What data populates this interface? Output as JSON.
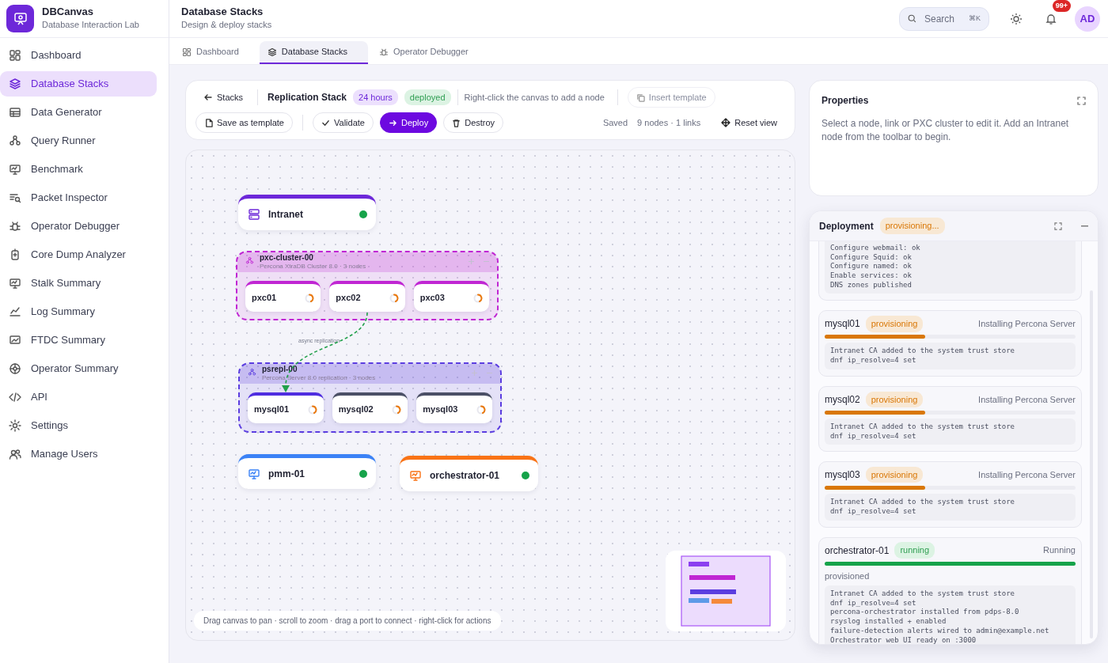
{
  "app": {
    "name": "DBCanvas",
    "subtitle": "Database Interaction Lab"
  },
  "sidebar": {
    "items": [
      {
        "label": "Dashboard",
        "selected": false
      },
      {
        "label": "Database Stacks",
        "selected": true
      },
      {
        "label": "Data Generator",
        "selected": false
      },
      {
        "label": "Query Runner",
        "selected": false
      },
      {
        "label": "Benchmark",
        "selected": false
      },
      {
        "label": "Packet Inspector",
        "selected": false
      },
      {
        "label": "Operator Debugger",
        "selected": false
      },
      {
        "label": "Core Dump Analyzer",
        "selected": false
      },
      {
        "label": "Stalk Summary",
        "selected": false
      },
      {
        "label": "Log Summary",
        "selected": false
      },
      {
        "label": "FTDC Summary",
        "selected": false
      },
      {
        "label": "Operator Summary",
        "selected": false
      },
      {
        "label": "API",
        "selected": false
      },
      {
        "label": "Settings",
        "selected": false
      },
      {
        "label": "Manage Users",
        "selected": false
      }
    ]
  },
  "header": {
    "title": "Database Stacks",
    "subtitle": "Design & deploy stacks",
    "search": {
      "placeholder": "Search",
      "shortcut": "⌘K"
    },
    "notifications": "99+",
    "avatar": "AD"
  },
  "tabs": [
    {
      "label": "Dashboard",
      "selected": false
    },
    {
      "label": "Database Stacks",
      "selected": true
    },
    {
      "label": "Operator Debugger",
      "selected": false
    }
  ],
  "toolbar": {
    "back": "Stacks",
    "stack_name": "Replication Stack",
    "badges": [
      {
        "text": "24 hours",
        "kind": "info"
      },
      {
        "text": "deployed",
        "kind": "success"
      }
    ],
    "hint": "Right-click the canvas to add a node",
    "insert_template": "Insert template",
    "actions": [
      {
        "label": "Save as template",
        "kind": "default"
      },
      {
        "label": "Validate",
        "kind": "default"
      },
      {
        "label": "Deploy",
        "kind": "primary"
      },
      {
        "label": "Destroy",
        "kind": "default"
      }
    ],
    "saved": "Saved",
    "counts": "9 nodes · 1 links",
    "reset": "Reset view"
  },
  "canvas": {
    "nodes": [
      {
        "kind": "host",
        "label": "Intranet",
        "color": "#6d28d9",
        "ready": true
      },
      {
        "kind": "group",
        "label": "pxc-cluster-00",
        "subtitle": "Percona XtraDB Cluster 8.0 · 3 nodes",
        "color": "#c026d3",
        "children": [
          {
            "label": "pxc01",
            "color": "#c026d3",
            "ready": false
          },
          {
            "label": "pxc02",
            "color": "#c026d3",
            "ready": false
          },
          {
            "label": "pxc03",
            "color": "#c026d3",
            "ready": false
          }
        ]
      },
      {
        "kind": "group",
        "label": "psrepl-00",
        "subtitle": "Percona Server 8.0 replication · 3 nodes",
        "color": "#5b3de0",
        "children": [
          {
            "label": "mysql01",
            "color": "#4f2de0",
            "ready": false
          },
          {
            "label": "mysql02",
            "color": "#4b5066",
            "ready": false
          },
          {
            "label": "mysql03",
            "color": "#4b5066",
            "ready": false
          }
        ]
      },
      {
        "kind": "host",
        "label": "pmm-01",
        "color": "#3b82f6",
        "ready": true
      },
      {
        "kind": "host",
        "label": "orchestrator-01",
        "color": "#f97316",
        "ready": true
      }
    ],
    "links": [
      {
        "label": "async replication"
      }
    ],
    "hint": "Drag canvas to pan · scroll to zoom · drag a port to connect · right-click for actions"
  },
  "properties": {
    "title": "Properties",
    "text": "Select a node, link or PXC cluster to edit it. Add an Intranet node from the toolbar to begin."
  },
  "deployment": {
    "title": "Deployment",
    "status": "provisioning...",
    "items": [
      {
        "kind": "log-only",
        "log": [
          "Configure webmail: ok",
          "Configure Squid: ok",
          "Configure named: ok",
          "Enable services: ok",
          "DNS zones published"
        ]
      },
      {
        "kind": "host",
        "name": "mysql01",
        "status": {
          "text": "provisioning",
          "kind": "warning"
        },
        "step": "Installing Percona Server",
        "level": 0.4,
        "log": [
          "Intranet CA added to the system trust store",
          "dnf ip_resolve=4 set"
        ]
      },
      {
        "kind": "host",
        "name": "mysql02",
        "status": {
          "text": "provisioning",
          "kind": "warning"
        },
        "step": "Installing Percona Server",
        "level": 0.4,
        "log": [
          "Intranet CA added to the system trust store",
          "dnf ip_resolve=4 set"
        ]
      },
      {
        "kind": "host",
        "name": "mysql03",
        "status": {
          "text": "provisioning",
          "kind": "warning"
        },
        "step": "Installing Percona Server",
        "level": 0.4,
        "log": [
          "Intranet CA added to the system trust store",
          "dnf ip_resolve=4 set"
        ]
      },
      {
        "kind": "host",
        "name": "orchestrator-01",
        "status": {
          "text": "running",
          "kind": "success"
        },
        "step": "Running",
        "level": 1,
        "note": "provisioned",
        "log": [
          "Intranet CA added to the system trust store",
          "dnf ip_resolve=4 set",
          "percona-orchestrator installed from pdps-8.0",
          "rsyslog installed + enabled",
          "failure-detection alerts wired to admin@example.net",
          "Orchestrator web UI ready on :3000"
        ]
      }
    ]
  }
}
